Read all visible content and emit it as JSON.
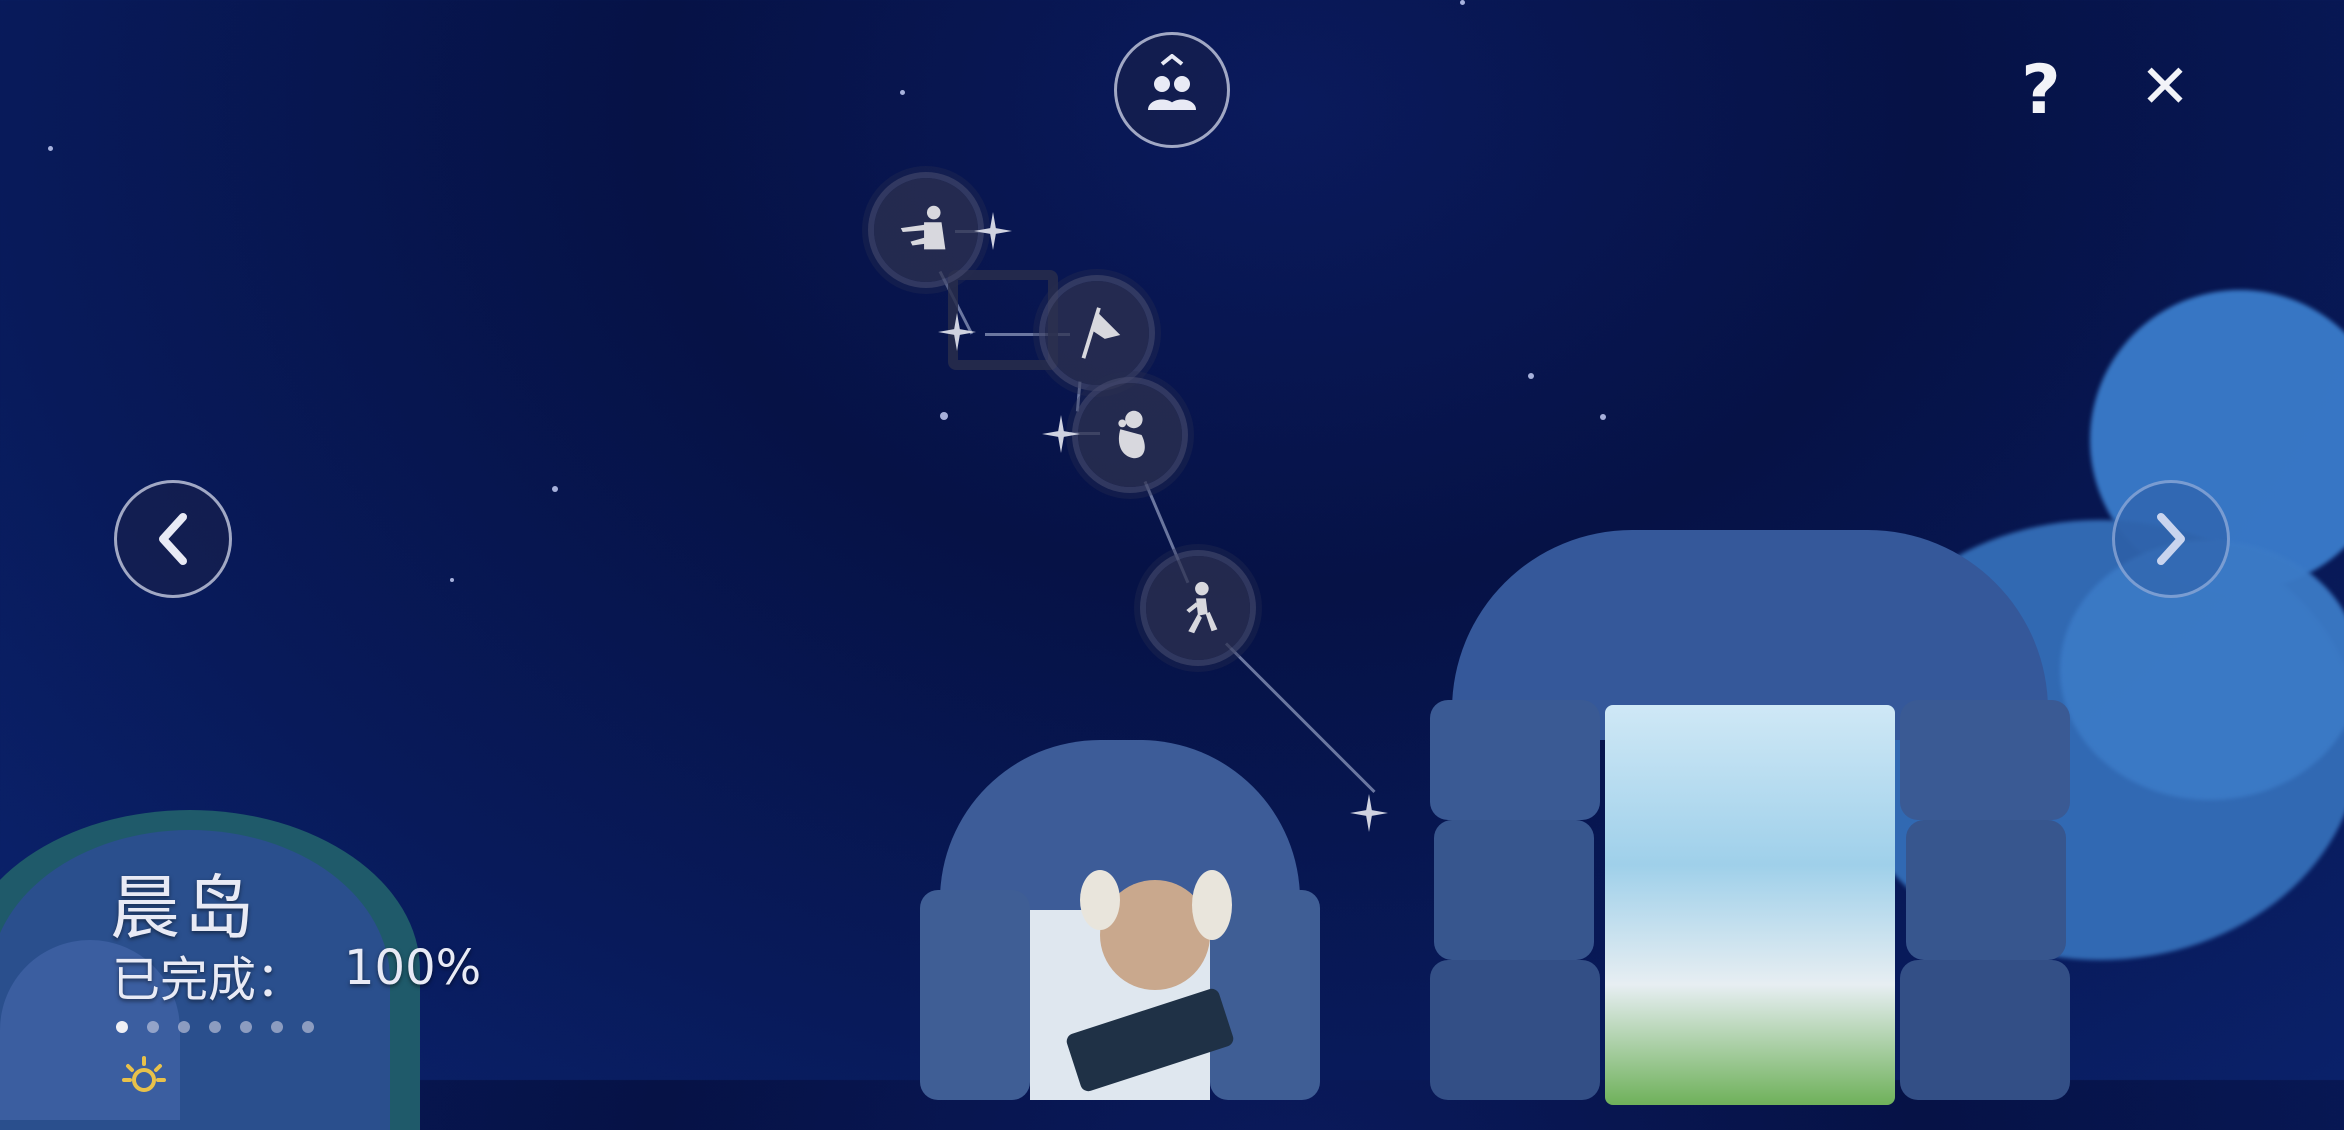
{
  "realm": {
    "name": "晨岛",
    "progress_label": "已完成：",
    "progress_value": "100%",
    "page_count": 7,
    "active_page": 0
  },
  "controls": {
    "help_label": "?",
    "close_label": "✕",
    "friends_icon": "friends-icon",
    "prev_icon": "chevron-left-icon",
    "next_icon": "chevron-right-icon"
  },
  "constellation": {
    "spirits": [
      {
        "name": "pointing-spirit-icon"
      },
      {
        "name": "flag-spirit-icon"
      },
      {
        "name": "crouching-spirit-icon"
      },
      {
        "name": "walking-spirit-icon"
      }
    ]
  },
  "colors": {
    "sky": "#061246",
    "ui_stroke": "#d2d7eb",
    "text": "#e8eaf5"
  }
}
